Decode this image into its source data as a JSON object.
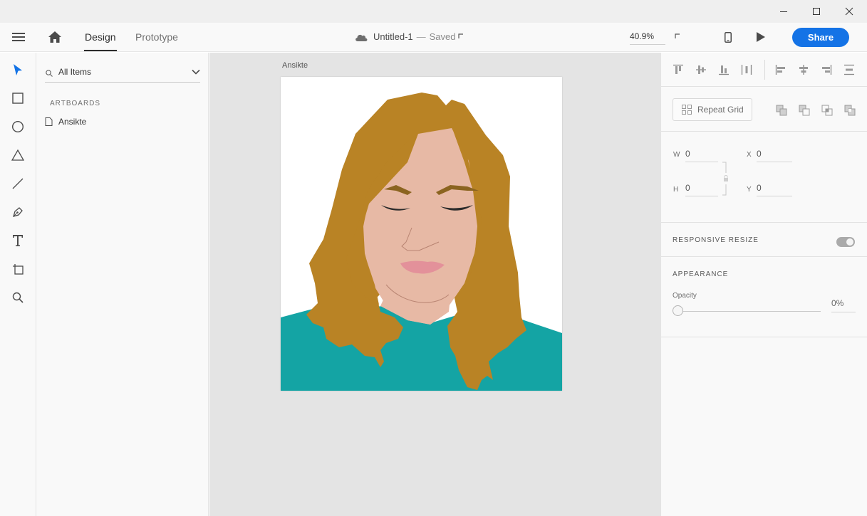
{
  "window": {
    "controls": [
      "minimize-icon",
      "maximize-icon",
      "close-icon"
    ]
  },
  "appbar": {
    "tabs": [
      {
        "label": "Design",
        "active": true
      },
      {
        "label": "Prototype",
        "active": false
      }
    ],
    "document": {
      "title": "Untitled-1",
      "separator": "—",
      "status": "Saved"
    },
    "zoom": "40.9%",
    "share_label": "Share",
    "accent_color": "#1473e6"
  },
  "tools": [
    "select-icon",
    "rectangle-icon",
    "ellipse-icon",
    "polygon-icon",
    "line-icon",
    "pen-icon",
    "text-icon",
    "artboard-icon",
    "zoom-icon"
  ],
  "layers": {
    "filter": "All Items",
    "section_label": "ARTBOARDS",
    "items": [
      {
        "label": "Ansikte"
      }
    ]
  },
  "canvas": {
    "artboard_label": "Ansikte",
    "colors": {
      "hair": "#b98325",
      "skin": "#e7b9a5",
      "shirt": "#14a4a4",
      "lips": "#e3919a",
      "brows": "#8b6420",
      "lashes": "#2b2b2b"
    }
  },
  "props": {
    "repeat_grid_label": "Repeat Grid",
    "transform": {
      "w_label": "W",
      "w_value": "0",
      "h_label": "H",
      "h_value": "0",
      "x_label": "X",
      "x_value": "0",
      "y_label": "Y",
      "y_value": "0"
    },
    "responsive_resize_label": "RESPONSIVE RESIZE",
    "responsive_resize_on": true,
    "appearance_label": "APPEARANCE",
    "opacity_label": "Opacity",
    "opacity_value": "0%"
  }
}
